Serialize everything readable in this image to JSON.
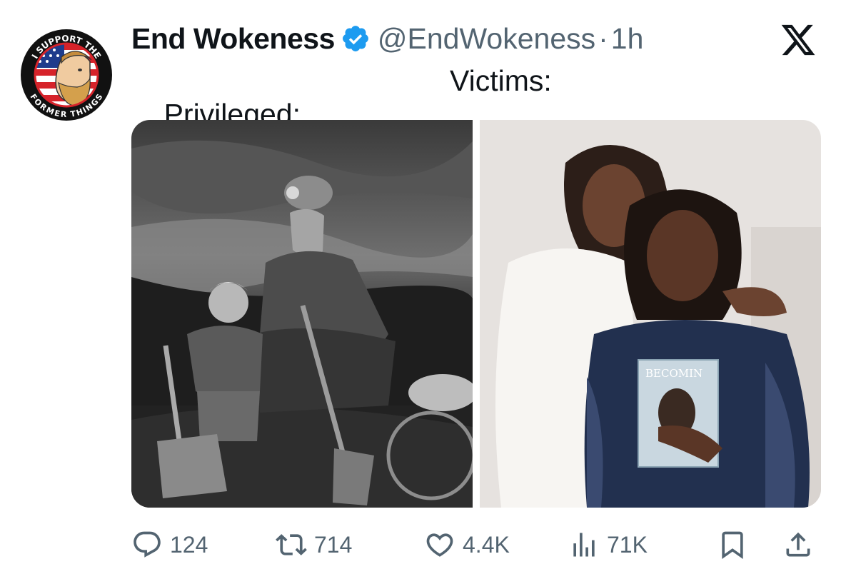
{
  "avatar": {
    "text_top": "I SUPPORT THE",
    "text_bottom": "FORMER THINGS"
  },
  "author": {
    "display_name": "End Wokeness",
    "handle": "@EndWokeness",
    "separator": "·",
    "time": "1h",
    "verified_icon": "verified-badge-icon",
    "verified_color": "#1d9bf0"
  },
  "platform_logo": "x-logo-icon",
  "tweet": {
    "label_left": "Privileged:",
    "label_right": "Victims:"
  },
  "media": {
    "left_image": "Black and white photograph of a coal miner with a young boy holding shovels at a mine entrance",
    "right_image": "Two smiling women embracing, one holding a book",
    "book_title_fragment": "BECOMIN"
  },
  "actions": {
    "reply_count": "124",
    "retweet_count": "714",
    "like_count": "4.4K",
    "views_count": "71K"
  },
  "colors": {
    "text_primary": "#0f1419",
    "text_secondary": "#536471",
    "accent": "#1d9bf0"
  }
}
